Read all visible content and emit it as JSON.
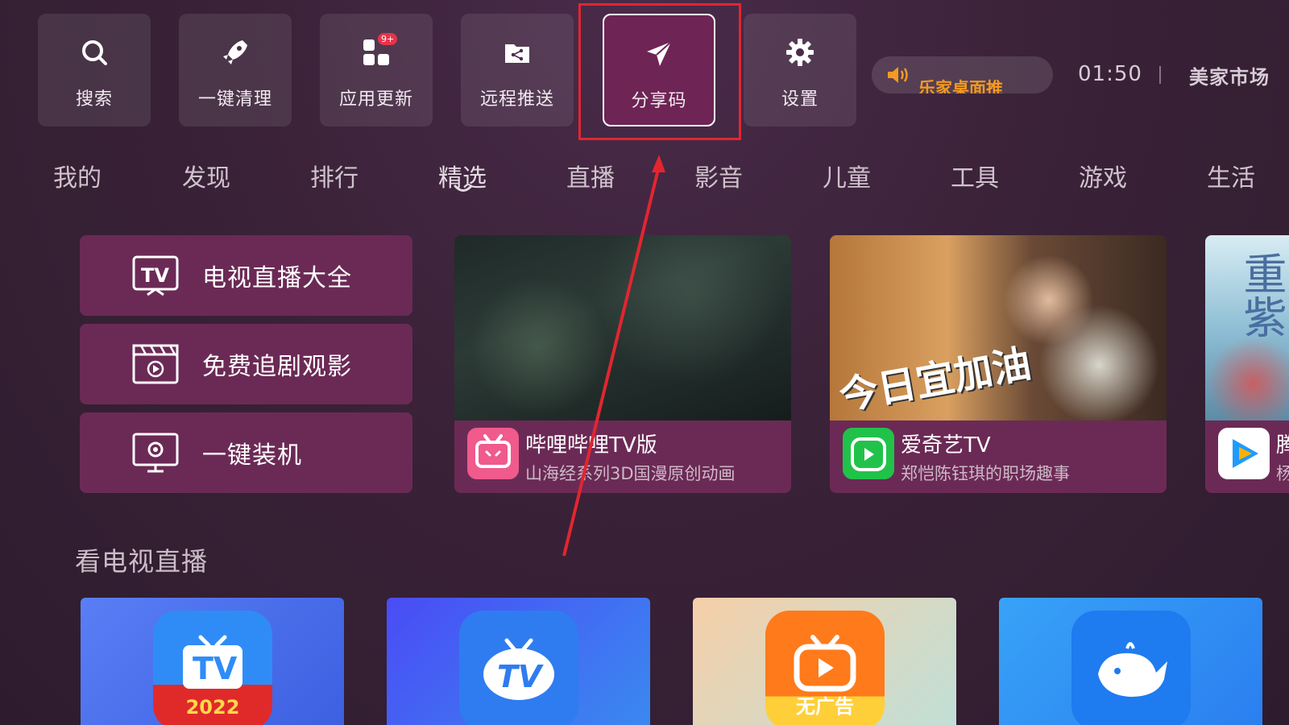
{
  "toolbar": {
    "items": [
      {
        "label": "搜索",
        "icon": "search-icon"
      },
      {
        "label": "一键清理",
        "icon": "rocket-icon"
      },
      {
        "label": "应用更新",
        "icon": "apps-grid-icon",
        "badge": "9+"
      },
      {
        "label": "远程推送",
        "icon": "share-folder-icon"
      },
      {
        "label": "分享码",
        "icon": "paper-plane-icon"
      },
      {
        "label": "设置",
        "icon": "gear-icon"
      }
    ],
    "focused_index": 4
  },
  "status": {
    "notice_text": "乐家桌面推",
    "time": "01:50",
    "store_label": "美家市场",
    "notice_color": "#f39a1f"
  },
  "tabs": {
    "items": [
      "我的",
      "发现",
      "排行",
      "精选",
      "直播",
      "影音",
      "儿童",
      "工具",
      "游戏",
      "生活"
    ],
    "active_index": 3
  },
  "shortcuts": [
    {
      "label": "电视直播大全",
      "icon": "tv-icon"
    },
    {
      "label": "免费追剧观影",
      "icon": "clapperboard-icon"
    },
    {
      "label": "一键装机",
      "icon": "monitor-gear-icon"
    }
  ],
  "cards": [
    {
      "title": "哔哩哔哩TV版",
      "subtitle": "山海经系列3D国漫原创动画",
      "icon": "bilibili-icon",
      "icon_color": "#f05a8c"
    },
    {
      "title": "爱奇艺TV",
      "subtitle": "郑恺陈钰琪的职场趣事",
      "icon": "iqiyi-icon",
      "icon_color": "#21c24a",
      "poster_text": "今日宜加油"
    },
    {
      "title": "腾",
      "subtitle": "杨",
      "icon": "tencent-video-icon",
      "icon_color": "#1e9bff",
      "poster_text": "重紫"
    }
  ],
  "section": {
    "title": "看电视直播"
  },
  "live_apps": [
    {
      "icon": "tv-2022-icon",
      "badge": "2022",
      "bg": "#3f5fe0"
    },
    {
      "icon": "tv-cloud-icon",
      "bg": "#3b3ff0"
    },
    {
      "icon": "play-tv-icon",
      "badge": "无广告",
      "bg": "#f2c9a0"
    },
    {
      "icon": "whale-icon",
      "bg": "#2a8af0"
    }
  ],
  "colors": {
    "accent_card": "#6b2a55",
    "focus_bg": "#6e2455",
    "annotation_red": "#e12630"
  }
}
